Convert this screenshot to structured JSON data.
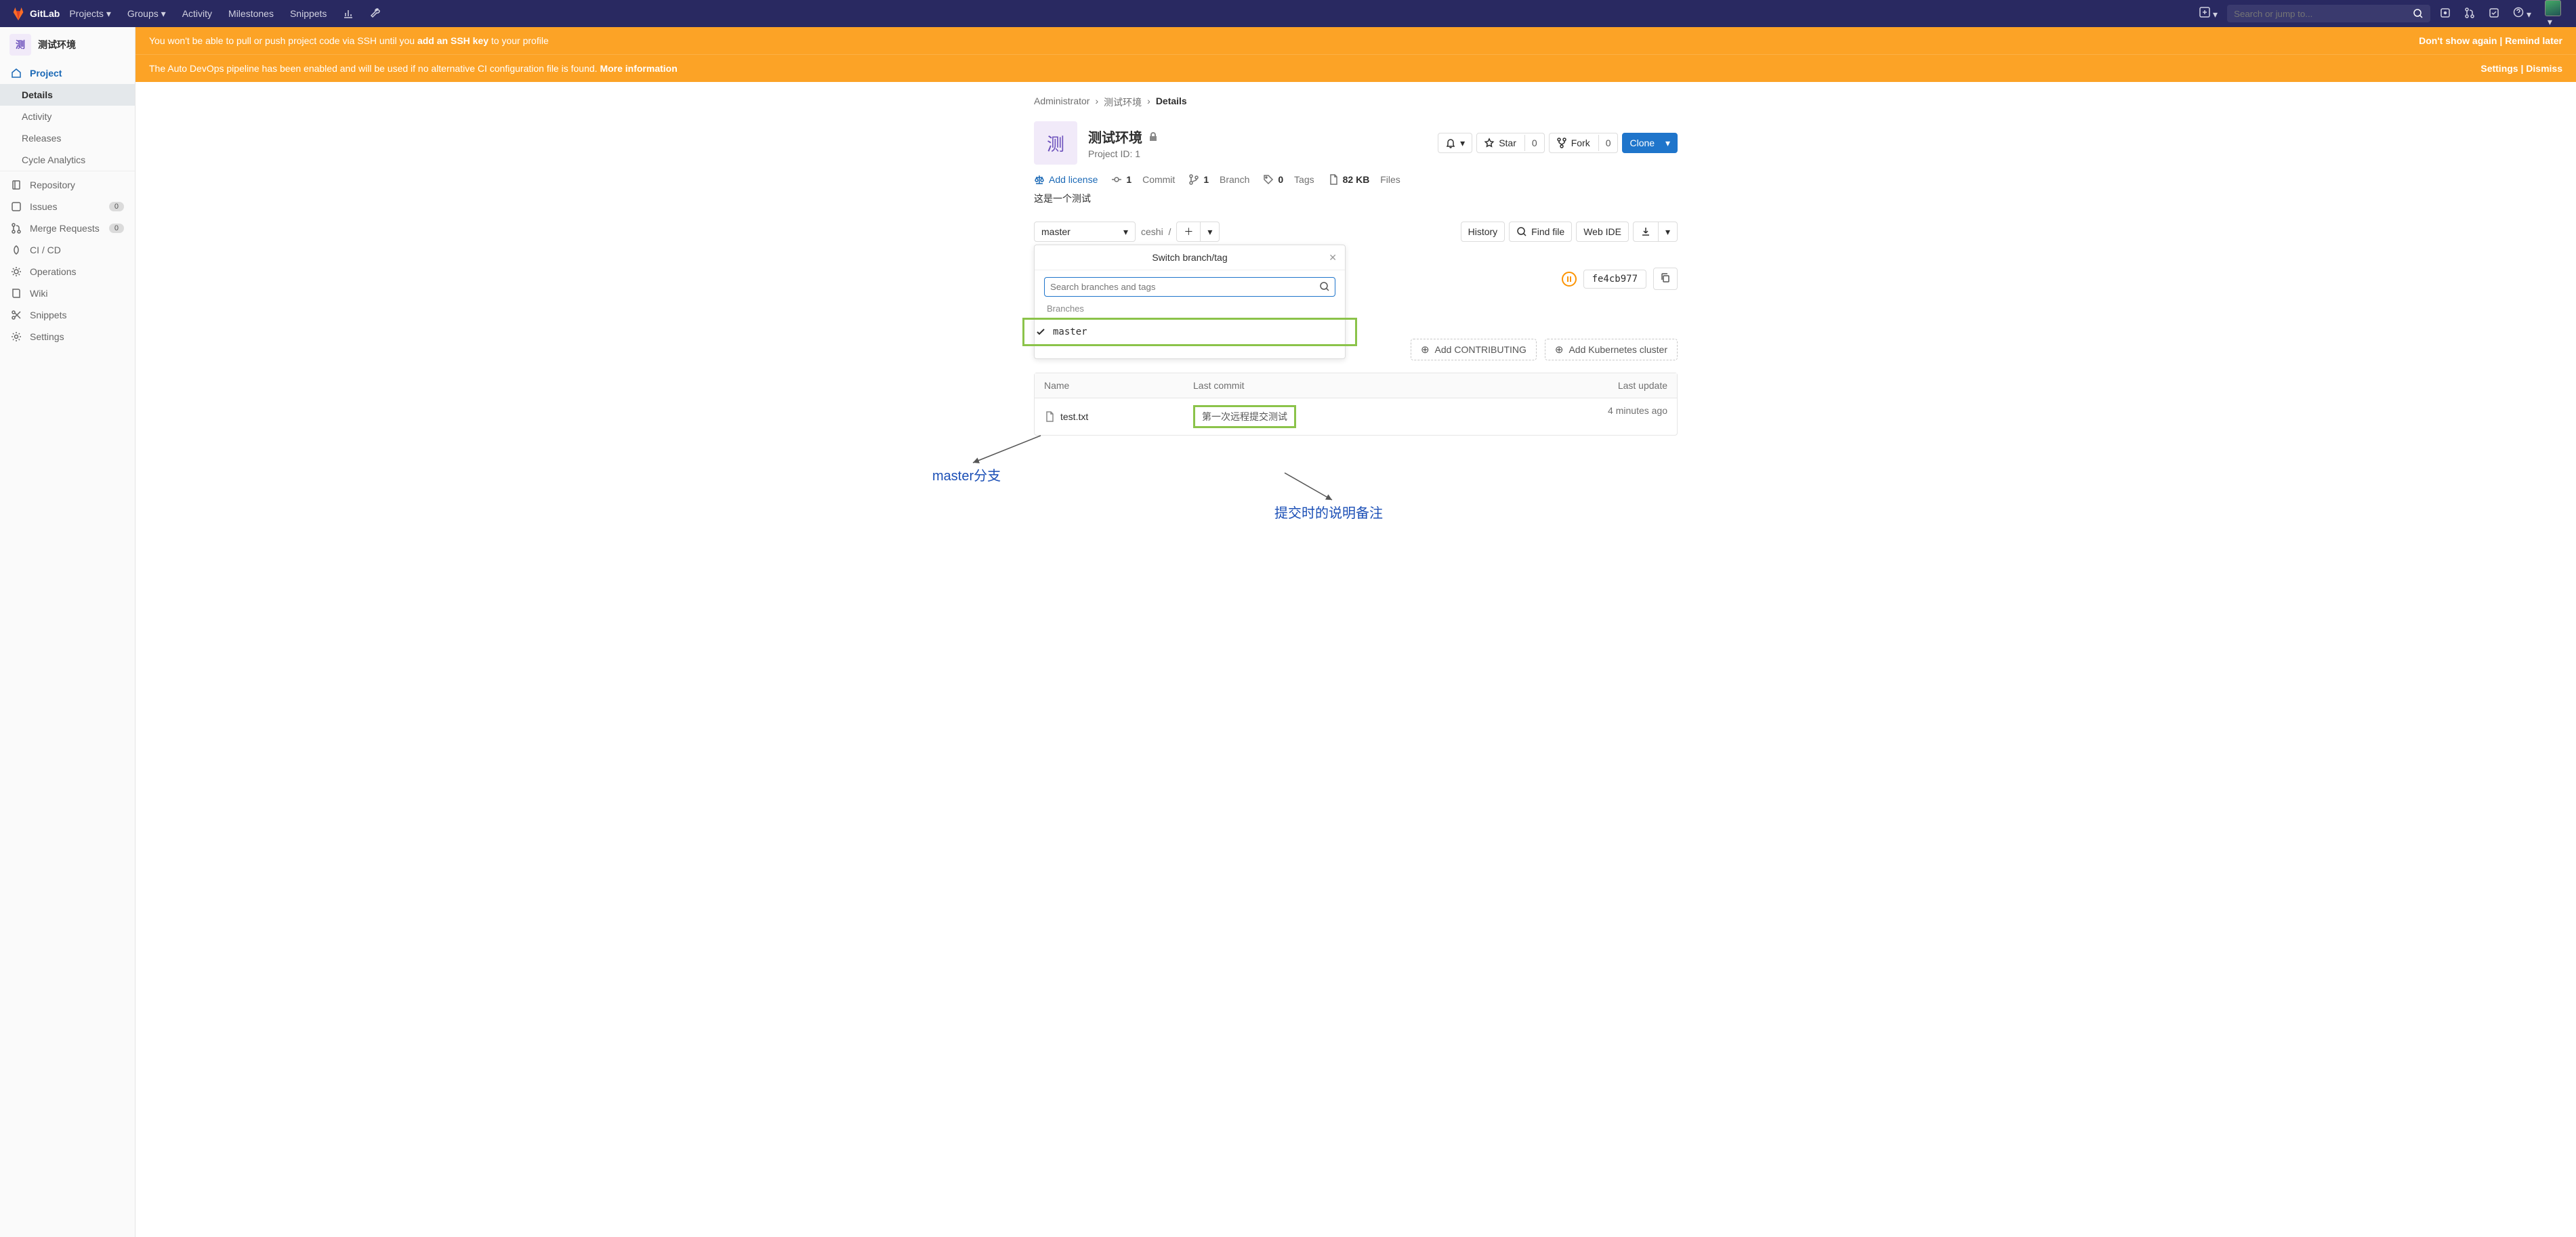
{
  "navbar": {
    "brand": "GitLab",
    "items": [
      "Projects",
      "Groups",
      "Activity",
      "Milestones",
      "Snippets"
    ],
    "search_placeholder": "Search or jump to..."
  },
  "sidebar": {
    "avatar_letter": "测",
    "title": "测试环境",
    "project_label": "Project",
    "sub_items": [
      "Details",
      "Activity",
      "Releases",
      "Cycle Analytics"
    ],
    "items": [
      {
        "label": "Repository"
      },
      {
        "label": "Issues",
        "badge": "0"
      },
      {
        "label": "Merge Requests",
        "badge": "0"
      },
      {
        "label": "CI / CD"
      },
      {
        "label": "Operations"
      },
      {
        "label": "Wiki"
      },
      {
        "label": "Snippets"
      },
      {
        "label": "Settings"
      }
    ]
  },
  "alerts": {
    "ssh_pre": "You won't be able to pull or push project code via SSH until you ",
    "ssh_bold": "add an SSH key",
    "ssh_post": " to your profile",
    "ssh_act1": "Don't show again",
    "ssh_act2": "Remind later",
    "devops_pre": "The Auto DevOps pipeline has been enabled and will be used if no alternative CI configuration file is found. ",
    "devops_bold": "More information",
    "devops_act1": "Settings",
    "devops_act2": "Dismiss"
  },
  "breadcrumb": {
    "a": "Administrator",
    "b": "测试环境",
    "c": "Details"
  },
  "project": {
    "avatar_letter": "测",
    "title": "测试环境",
    "id_label": "Project ID: 1",
    "star_label": "Star",
    "star_count": "0",
    "fork_label": "Fork",
    "fork_count": "0",
    "clone_label": "Clone"
  },
  "stats": {
    "add_license": "Add license",
    "commits_n": "1",
    "commits_l": "Commit",
    "branch_n": "1",
    "branch_l": "Branch",
    "tags_n": "0",
    "tags_l": "Tags",
    "size_n": "82 KB",
    "size_l": "Files"
  },
  "description": "这是一个测试",
  "tree": {
    "branch": "master",
    "path": "ceshi",
    "sep": "/",
    "history": "History",
    "find_file": "Find file",
    "web_ide": "Web IDE"
  },
  "dropdown": {
    "title": "Switch branch/tag",
    "search_placeholder": "Search branches and tags",
    "branches_label": "Branches",
    "branch_name": "master"
  },
  "commit": {
    "status_glyph": "⏸",
    "sha": "fe4cb977"
  },
  "chips": {
    "contributing": "Add CONTRIBUTING",
    "k8s": "Add Kubernetes cluster"
  },
  "table": {
    "head_name": "Name",
    "head_commit": "Last commit",
    "head_update": "Last update",
    "file_name": "test.txt",
    "commit_msg": "第一次远程提交测试",
    "update": "4 minutes ago"
  },
  "annotations": {
    "left": "master分支",
    "right": "提交时的说明备注"
  }
}
